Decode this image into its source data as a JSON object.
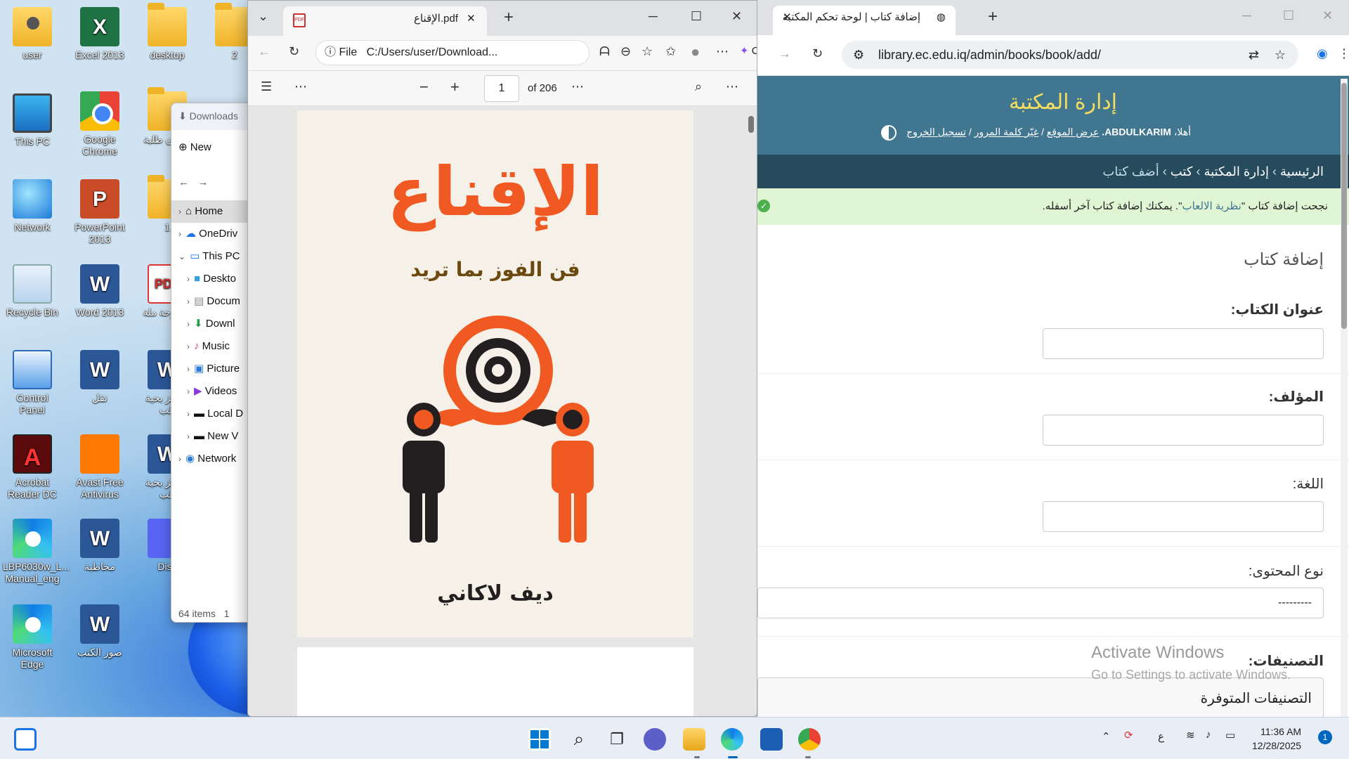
{
  "desktop": {
    "icons": [
      {
        "label": "user"
      },
      {
        "label": "Excel 2013"
      },
      {
        "label": "desktop"
      },
      {
        "label": "2"
      },
      {
        "label": "This PC"
      },
      {
        "label": "Google Chrome"
      },
      {
        "label": "شؤون طلبة"
      },
      {
        "label": "Network"
      },
      {
        "label": "PowerPoint 2013"
      },
      {
        "label": "1"
      },
      {
        "label": "Recycle Bin"
      },
      {
        "label": "Word 2013"
      },
      {
        "label": "اطروحة ملة"
      },
      {
        "label": "Control Panel"
      },
      {
        "label": "نقل"
      },
      {
        "label": "مراكز بحية الب"
      },
      {
        "label": "Acrobat Reader DC"
      },
      {
        "label": "Avast Free Antivirus"
      },
      {
        "label": "مراكز بحية الب"
      },
      {
        "label": "LBP6030w_L... Manual_eng"
      },
      {
        "label": "مخاطبة"
      },
      {
        "label": "Disc"
      },
      {
        "label": "Microsoft Edge"
      },
      {
        "label": "صور الكتب"
      }
    ]
  },
  "explorer": {
    "header": "Downloads",
    "new_label": "New",
    "items": [
      "Home",
      "OneDriv",
      "This PC",
      "Deskto",
      "Docum",
      "Downl",
      "Music",
      "Picture",
      "Videos",
      "Local D",
      "New V",
      "Network"
    ],
    "status": "64 items",
    "status_suffix": "1"
  },
  "edge": {
    "tab_title": "الإقناع.pdf",
    "omnibox_scheme": "File",
    "omnibox_path": "C:/Users/user/Download...",
    "chat_label": "Chat",
    "page_current": "1",
    "page_total": "of 206",
    "book": {
      "title": "الإقناع",
      "subtitle": "فن الفوز بما تريد",
      "author": "ديف لاكاني"
    },
    "colors": {
      "accent": "#f05a22",
      "dark": "#231f20",
      "subtitle": "#6b4a10"
    }
  },
  "chrome": {
    "tab_title": "إضافة كتاب | لوحة تحكم المكتبة",
    "url": "library.ec.edu.iq/admin/books/book/add/",
    "site_title": "إدارة المكتبة",
    "user_greeting": "أهلا،",
    "user_name": "ABDULKARIM.",
    "view_site": "عرض الموقع",
    "change_password": "غيّر كلمة المرور",
    "logout": "تسجيل الخروج",
    "breadcrumbs": {
      "home": "الرئيسية",
      "app": "إدارة المكتبة",
      "model": "كتب",
      "current": "أضف كتاب",
      "sep": "›"
    },
    "success_prefix": "نجحت إضافة كتاب \"",
    "success_link": "نظرية الالعاب",
    "success_suffix": "\". يمكنك إضافة كتاب آخر أسفله.",
    "form_title": "إضافة كتاب",
    "fields": {
      "title_label": "عنوان الكتاب:",
      "author_label": "المؤلف:",
      "language_label": "اللغة:",
      "content_type_label": "نوع المحتوى:",
      "content_type_value": "---------",
      "categories_label": "التصنيفات:",
      "available_categories": "التصنيفات المتوفرة"
    },
    "colors": {
      "header": "#417690",
      "breadcrumbs": "#264b5d",
      "title": "#f5dd5d",
      "success": "#dff5d4"
    }
  },
  "watermark": {
    "line1": "Activate Windows",
    "line2": "Go to Settings to activate Windows."
  },
  "taskbar": {
    "time": "11:36 AM",
    "date": "12/28/2025",
    "lang": "ع",
    "notif_count": "1"
  }
}
